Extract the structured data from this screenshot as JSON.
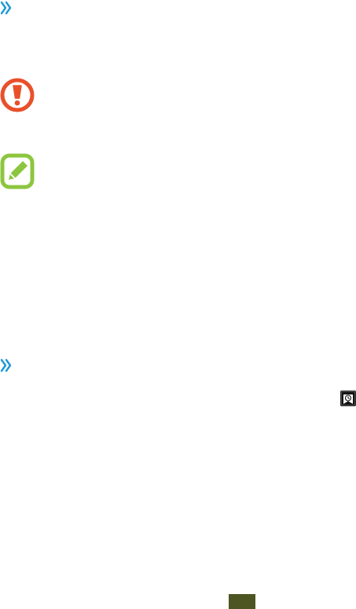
{
  "icons": {
    "section_marker": "double-chevron-right-icon",
    "warning": "warning-exclamation-icon",
    "note": "note-pen-icon",
    "recent": "recent-clock-icon"
  },
  "colors": {
    "chevron": "#1e98d6",
    "warning": "#e9502a",
    "note": "#8cc63f",
    "clock_bg": "#111111",
    "olive_block": "#4d5523"
  }
}
